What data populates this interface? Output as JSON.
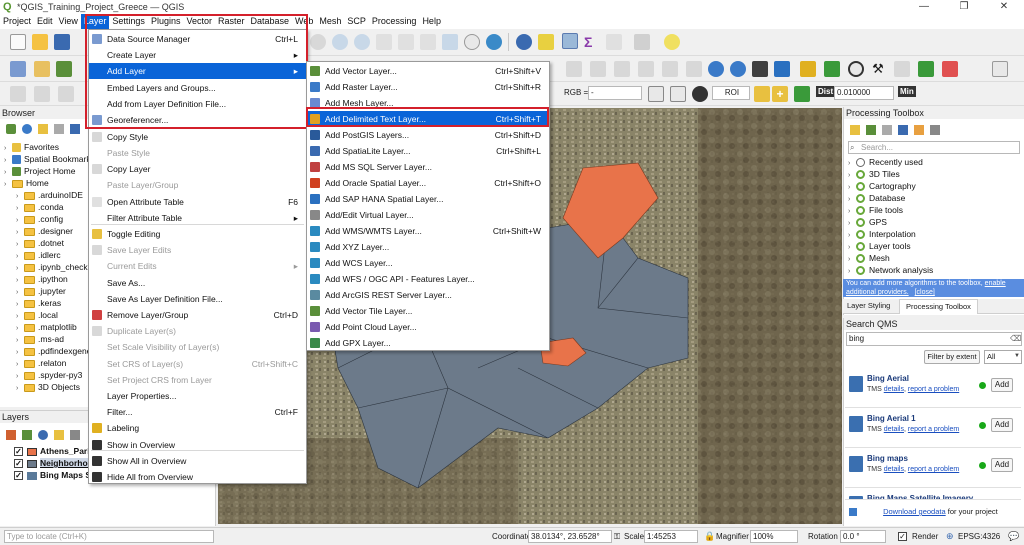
{
  "window": {
    "title": "*QGIS_Training_Project_Greece — QGIS",
    "minimize": "—",
    "maximize": "❐",
    "close": "✕"
  },
  "menubar": [
    "Project",
    "Edit",
    "View",
    "Layer",
    "Settings",
    "Plugins",
    "Vector",
    "Raster",
    "Database",
    "Web",
    "Mesh",
    "SCP",
    "Processing",
    "Help"
  ],
  "toolbar": {
    "rgb_label": "RGB =",
    "rgb_value": "-",
    "roi_label": "ROI",
    "dist_label": "Dist",
    "dist_value": "0.010000",
    "min_label": "Min"
  },
  "browser": {
    "title": "Browser",
    "items": [
      {
        "label": "Favorites",
        "level": 0
      },
      {
        "label": "Spatial Bookmarks",
        "level": 0
      },
      {
        "label": "Project Home",
        "level": 0
      },
      {
        "label": "Home",
        "level": 0
      },
      {
        "label": ".arduinoIDE",
        "level": 1
      },
      {
        "label": ".conda",
        "level": 1
      },
      {
        "label": ".config",
        "level": 1
      },
      {
        "label": ".designer",
        "level": 1
      },
      {
        "label": ".dotnet",
        "level": 1
      },
      {
        "label": ".idlerc",
        "level": 1
      },
      {
        "label": ".ipynb_checkpoints",
        "level": 1
      },
      {
        "label": ".ipython",
        "level": 1
      },
      {
        "label": ".jupyter",
        "level": 1
      },
      {
        "label": ".keras",
        "level": 1
      },
      {
        "label": ".local",
        "level": 1
      },
      {
        "label": ".matplotlib",
        "level": 1
      },
      {
        "label": ".ms-ad",
        "level": 1
      },
      {
        "label": ".pdfindexgenerator",
        "level": 1
      },
      {
        "label": ".relaton",
        "level": 1
      },
      {
        "label": ".spyder-py3",
        "level": 1
      },
      {
        "label": "3D Objects",
        "level": 1
      }
    ]
  },
  "layers": {
    "title": "Layers",
    "items": [
      {
        "label": "Athens_Parks",
        "color": "#e8734a"
      },
      {
        "label": "Neighborhoods",
        "color": "#6c7a8a"
      },
      {
        "label": "Bing Maps Satellite",
        "color": ""
      }
    ]
  },
  "layer_menu": {
    "items": [
      {
        "label": "Data Source Manager",
        "shortcut": "Ctrl+L",
        "disabled": false
      },
      {
        "label": "Create Layer",
        "shortcut": "",
        "submenu": true,
        "disabled": false
      },
      {
        "label": "Add Layer",
        "shortcut": "",
        "submenu": true,
        "disabled": false,
        "highlight": true
      },
      {
        "label": "Embed Layers and Groups...",
        "shortcut": "",
        "disabled": false
      },
      {
        "label": "Add from Layer Definition File...",
        "shortcut": "",
        "disabled": false
      },
      {
        "label": "Georeferencer...",
        "shortcut": "",
        "disabled": false
      },
      {
        "label": "Copy Style",
        "shortcut": "",
        "disabled": false
      },
      {
        "label": "Paste Style",
        "shortcut": "",
        "disabled": true
      },
      {
        "label": "Copy Layer",
        "shortcut": "",
        "disabled": false
      },
      {
        "label": "Paste Layer/Group",
        "shortcut": "",
        "disabled": true
      },
      {
        "label": "Open Attribute Table",
        "shortcut": "F6",
        "disabled": false
      },
      {
        "label": "Filter Attribute Table",
        "shortcut": "",
        "submenu": true,
        "disabled": false
      },
      {
        "label": "Toggle Editing",
        "shortcut": "",
        "disabled": false
      },
      {
        "label": "Save Layer Edits",
        "shortcut": "",
        "disabled": true
      },
      {
        "label": "Current Edits",
        "shortcut": "",
        "submenu": true,
        "disabled": true
      },
      {
        "label": "Save As...",
        "shortcut": "",
        "disabled": false
      },
      {
        "label": "Save As Layer Definition File...",
        "shortcut": "",
        "disabled": false
      },
      {
        "label": "Remove Layer/Group",
        "shortcut": "Ctrl+D",
        "disabled": false
      },
      {
        "label": "Duplicate Layer(s)",
        "shortcut": "",
        "disabled": true
      },
      {
        "label": "Set Scale Visibility of Layer(s)",
        "shortcut": "",
        "disabled": true
      },
      {
        "label": "Set CRS of Layer(s)",
        "shortcut": "Ctrl+Shift+C",
        "disabled": true
      },
      {
        "label": "Set Project CRS from Layer",
        "shortcut": "",
        "disabled": true
      },
      {
        "label": "Layer Properties...",
        "shortcut": "",
        "disabled": false
      },
      {
        "label": "Filter...",
        "shortcut": "Ctrl+F",
        "disabled": false
      },
      {
        "label": "Labeling",
        "shortcut": "",
        "disabled": false
      },
      {
        "label": "Show in Overview",
        "shortcut": "",
        "disabled": false
      },
      {
        "label": "Show All in Overview",
        "shortcut": "",
        "disabled": false
      },
      {
        "label": "Hide All from Overview",
        "shortcut": "",
        "disabled": false
      }
    ]
  },
  "add_layer_menu": {
    "items": [
      {
        "label": "Add Vector Layer...",
        "shortcut": "Ctrl+Shift+V",
        "color": "#5a8f3a"
      },
      {
        "label": "Add Raster Layer...",
        "shortcut": "Ctrl+Shift+R",
        "color": "#3a7ac8"
      },
      {
        "label": "Add Mesh Layer...",
        "shortcut": "",
        "color": "#6a8ad0"
      },
      {
        "label": "Add Delimited Text Layer...",
        "shortcut": "Ctrl+Shift+T",
        "color": "#e0a020",
        "highlight": true
      },
      {
        "label": "Add PostGIS Layers...",
        "shortcut": "Ctrl+Shift+D",
        "color": "#2a5a9a"
      },
      {
        "label": "Add SpatiaLite Layer...",
        "shortcut": "Ctrl+Shift+L",
        "color": "#3a6ab0"
      },
      {
        "label": "Add MS SQL Server Layer...",
        "shortcut": "",
        "color": "#c04040"
      },
      {
        "label": "Add Oracle Spatial Layer...",
        "shortcut": "Ctrl+Shift+O",
        "color": "#d04020"
      },
      {
        "label": "Add SAP HANA Spatial Layer...",
        "shortcut": "",
        "color": "#2a70c0"
      },
      {
        "label": "Add/Edit Virtual Layer...",
        "shortcut": "",
        "color": "#888888"
      },
      {
        "label": "Add WMS/WMTS Layer...",
        "shortcut": "Ctrl+Shift+W",
        "color": "#2a8ac0"
      },
      {
        "label": "Add XYZ Layer...",
        "shortcut": "",
        "color": "#2a8ac0"
      },
      {
        "label": "Add WCS Layer...",
        "shortcut": "",
        "color": "#2a8ac0"
      },
      {
        "label": "Add WFS / OGC API - Features Layer...",
        "shortcut": "",
        "color": "#2a8ac0"
      },
      {
        "label": "Add ArcGIS REST Server Layer...",
        "shortcut": "",
        "color": "#5a8aa0"
      },
      {
        "label": "Add Vector Tile Layer...",
        "shortcut": "",
        "color": "#5a8f3a"
      },
      {
        "label": "Add Point Cloud Layer...",
        "shortcut": "",
        "color": "#7a5ab0"
      },
      {
        "label": "Add GPX Layer...",
        "shortcut": "",
        "color": "#3a8a4a"
      }
    ]
  },
  "processing_toolbox": {
    "title": "Processing Toolbox",
    "search_placeholder": "Search...",
    "items": [
      "Recently used",
      "3D Tiles",
      "Cartography",
      "Database",
      "File tools",
      "GPS",
      "Interpolation",
      "Layer tools",
      "Mesh",
      "Network analysis"
    ],
    "info_text": "You can add more algorithms to the toolbox,",
    "info_link1": "enable additional providers.",
    "info_link2": "[close]",
    "tab1": "Layer Styling",
    "tab2": "Processing Toolbox"
  },
  "search_qms": {
    "title": "Search QMS",
    "query": "bing",
    "filter_button": "Filter by extent",
    "filter_select": "All",
    "results": [
      {
        "name": "Bing Aerial",
        "type": "TMS",
        "details": "details",
        "report": "report a problem",
        "add": "Add"
      },
      {
        "name": "Bing Aerial 1",
        "type": "TMS",
        "details": "details",
        "report": "report a problem",
        "add": "Add"
      },
      {
        "name": "Bing maps",
        "type": "TMS",
        "details": "details",
        "report": "report a problem",
        "add": "Add"
      },
      {
        "name": "Bing Maps Satellite Imagery",
        "type": "",
        "details": "",
        "report": "",
        "add": ""
      }
    ],
    "download_link": "Download geodata",
    "download_suffix": "for your project"
  },
  "statusbar": {
    "locate_placeholder": "Type to locate (Ctrl+K)",
    "coordinate_label": "Coordinate",
    "coordinate_value": "38.0134°, 23.6528°",
    "scale_label": "Scale",
    "scale_value": "1:45253",
    "magnifier_label": "Magnifier",
    "magnifier_value": "100%",
    "rotation_label": "Rotation",
    "rotation_value": "0.0 °",
    "render_label": "Render",
    "crs_label": "EPSG:4326"
  },
  "colors": {
    "highlight": "#0a64d8",
    "red_box": "#d4202b",
    "parks": "#e8734a",
    "neighborhoods": "#6c7a8a"
  }
}
